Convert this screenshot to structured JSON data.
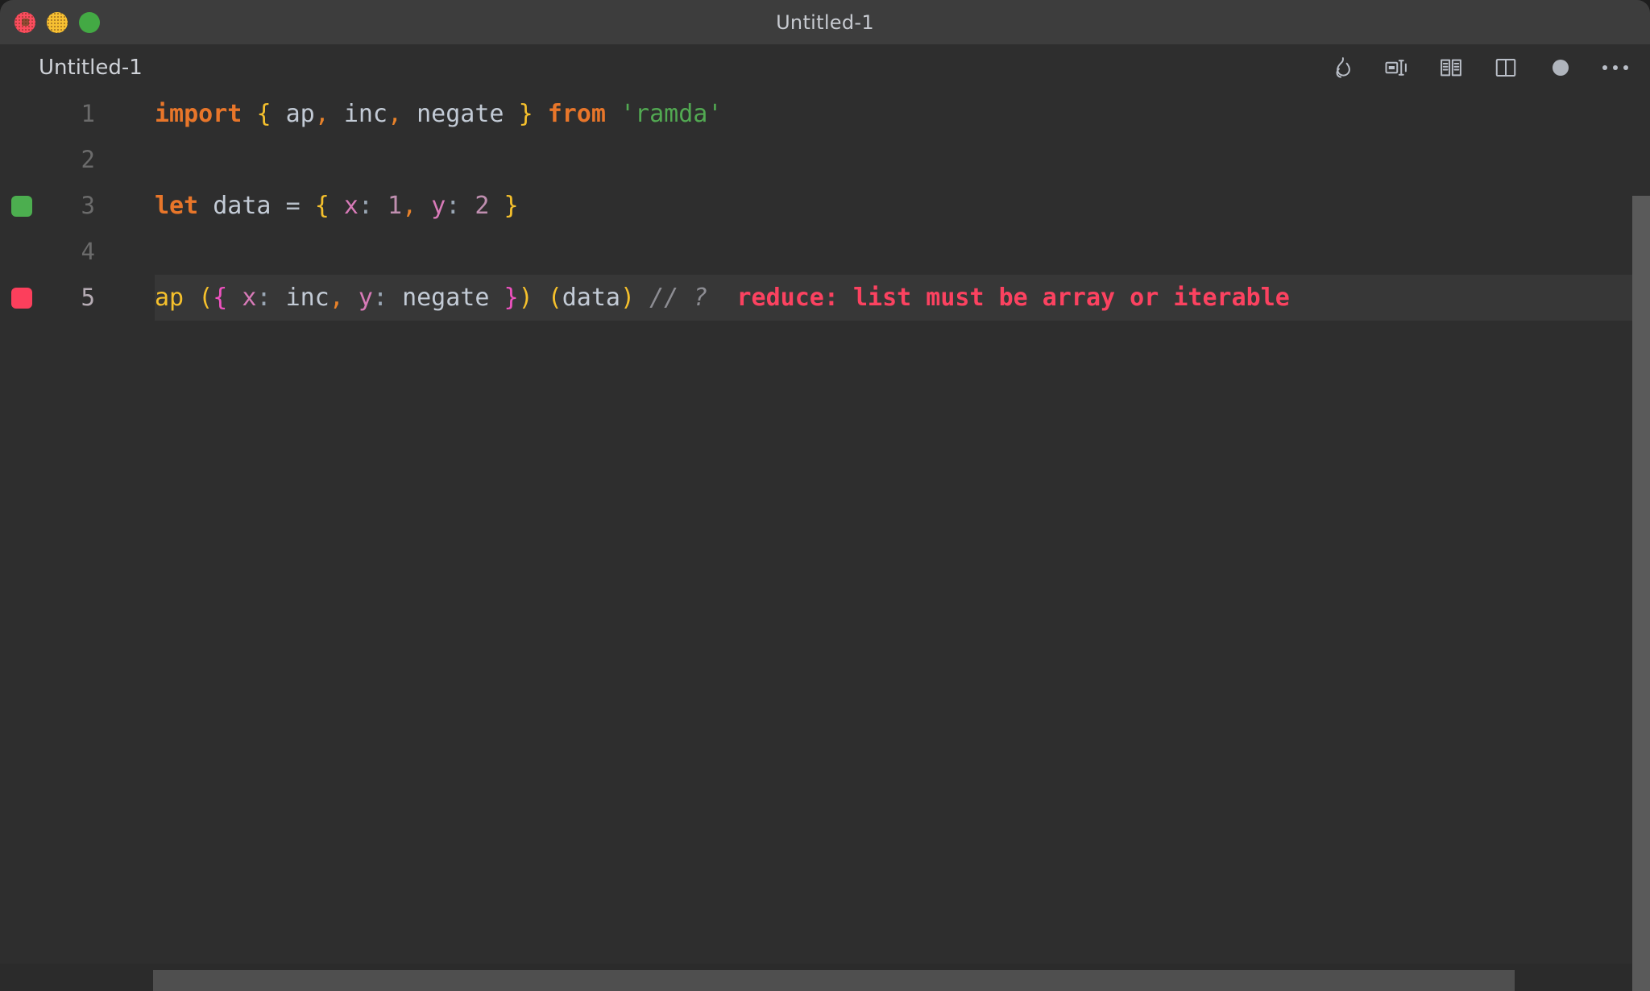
{
  "window": {
    "title": "Untitled-1",
    "traffic_lights": [
      {
        "name": "close",
        "color": "#fb4c5e"
      },
      {
        "name": "minimize",
        "color": "#f7c032"
      },
      {
        "name": "zoom",
        "color": "#43a944"
      }
    ]
  },
  "tab": {
    "label": "Untitled-1"
  },
  "toolbar": {
    "items": [
      {
        "icon": "flame-icon",
        "label": "Run / Quokka"
      },
      {
        "icon": "format-icon",
        "label": "Format Document"
      },
      {
        "icon": "open-book-icon",
        "label": "Open Preview"
      },
      {
        "icon": "split-editor-icon",
        "label": "Split Editor"
      },
      {
        "icon": "unsaved-dot-icon",
        "label": "Unsaved Changes"
      },
      {
        "icon": "ellipsis-icon",
        "label": "More Actions"
      }
    ]
  },
  "editor": {
    "language": "javascript",
    "line_count": 5,
    "active_line": 5,
    "lines": [
      {
        "number": "1",
        "marker": null,
        "active": false,
        "tokens": [
          {
            "t": "import",
            "c": "t-kw"
          },
          {
            "t": " ",
            "c": "t-ident"
          },
          {
            "t": "{",
            "c": "t-brace"
          },
          {
            "t": " ",
            "c": "t-ident"
          },
          {
            "t": "ap",
            "c": "t-ident"
          },
          {
            "t": ",",
            "c": "t-comma"
          },
          {
            "t": " ",
            "c": "t-ident"
          },
          {
            "t": "inc",
            "c": "t-ident"
          },
          {
            "t": ",",
            "c": "t-comma"
          },
          {
            "t": " ",
            "c": "t-ident"
          },
          {
            "t": "negate",
            "c": "t-ident"
          },
          {
            "t": " ",
            "c": "t-ident"
          },
          {
            "t": "}",
            "c": "t-brace"
          },
          {
            "t": " ",
            "c": "t-ident"
          },
          {
            "t": "from",
            "c": "t-kw"
          },
          {
            "t": " ",
            "c": "t-ident"
          },
          {
            "t": "'ramda'",
            "c": "t-string"
          }
        ],
        "plain": "import { ap, inc, negate } from 'ramda'"
      },
      {
        "number": "2",
        "marker": null,
        "active": false,
        "tokens": [],
        "plain": ""
      },
      {
        "number": "3",
        "marker": "green",
        "active": false,
        "tokens": [
          {
            "t": "let",
            "c": "t-kw"
          },
          {
            "t": " ",
            "c": "t-ident"
          },
          {
            "t": "data",
            "c": "t-ident"
          },
          {
            "t": " ",
            "c": "t-ident"
          },
          {
            "t": "=",
            "c": "t-op"
          },
          {
            "t": " ",
            "c": "t-ident"
          },
          {
            "t": "{",
            "c": "t-brace"
          },
          {
            "t": " ",
            "c": "t-ident"
          },
          {
            "t": "x",
            "c": "t-key"
          },
          {
            "t": ":",
            "c": "t-colon"
          },
          {
            "t": " ",
            "c": "t-ident"
          },
          {
            "t": "1",
            "c": "t-num"
          },
          {
            "t": ",",
            "c": "t-comma"
          },
          {
            "t": " ",
            "c": "t-ident"
          },
          {
            "t": "y",
            "c": "t-key"
          },
          {
            "t": ":",
            "c": "t-colon"
          },
          {
            "t": " ",
            "c": "t-ident"
          },
          {
            "t": "2",
            "c": "t-num"
          },
          {
            "t": " ",
            "c": "t-ident"
          },
          {
            "t": "}",
            "c": "t-brace"
          }
        ],
        "plain": "let data = { x: 1, y: 2 }"
      },
      {
        "number": "4",
        "marker": null,
        "active": false,
        "tokens": [],
        "plain": ""
      },
      {
        "number": "5",
        "marker": "red",
        "active": true,
        "tokens": [
          {
            "t": "ap",
            "c": "t-fn"
          },
          {
            "t": " ",
            "c": "t-ident"
          },
          {
            "t": "(",
            "c": "t-paren"
          },
          {
            "t": "{",
            "c": "t-brace2"
          },
          {
            "t": " ",
            "c": "t-ident"
          },
          {
            "t": "x",
            "c": "t-key"
          },
          {
            "t": ":",
            "c": "t-colon"
          },
          {
            "t": " ",
            "c": "t-ident"
          },
          {
            "t": "inc",
            "c": "t-ident"
          },
          {
            "t": ",",
            "c": "t-comma"
          },
          {
            "t": " ",
            "c": "t-ident"
          },
          {
            "t": "y",
            "c": "t-key"
          },
          {
            "t": ":",
            "c": "t-colon"
          },
          {
            "t": " ",
            "c": "t-ident"
          },
          {
            "t": "negate",
            "c": "t-ident"
          },
          {
            "t": " ",
            "c": "t-ident"
          },
          {
            "t": "}",
            "c": "t-brace2"
          },
          {
            "t": ")",
            "c": "t-paren"
          },
          {
            "t": " ",
            "c": "t-ident"
          },
          {
            "t": "(",
            "c": "t-paren"
          },
          {
            "t": "data",
            "c": "t-ident"
          },
          {
            "t": ")",
            "c": "t-paren"
          },
          {
            "t": " ",
            "c": "t-ident"
          },
          {
            "t": "// ?",
            "c": "t-comment"
          },
          {
            "t": "  ",
            "c": "t-ident"
          },
          {
            "t": "reduce: list must be array or iterable",
            "c": "t-error"
          }
        ],
        "plain": "ap ({ x: inc, y: negate }) (data) // ?  reduce: list must be array or iterable"
      }
    ],
    "inline_error": "reduce: list must be array or iterable"
  },
  "scrollbars": {
    "vertical_visible": true,
    "horizontal_visible": true
  },
  "colors": {
    "titlebar_bg": "#3d3d3d",
    "editor_bg": "#2e2e2e",
    "active_line_bg": "#373737",
    "marker_ok": "#4cae4f",
    "marker_error": "#fc3f5c",
    "error_text": "#fb4260",
    "keyword": "#e8762a",
    "string": "#52a952",
    "scrollbar": "#5a5a5a"
  }
}
